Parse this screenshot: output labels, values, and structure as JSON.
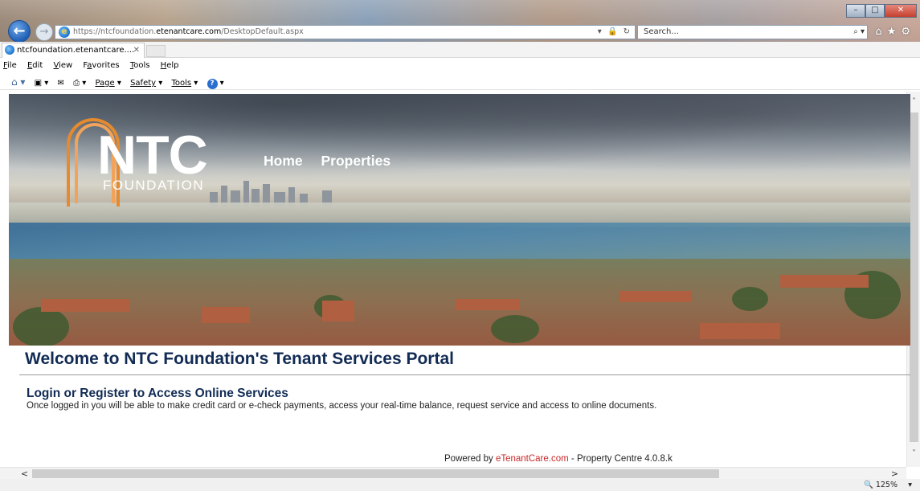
{
  "browser": {
    "url_prefix": "https://ntcfoundation.",
    "url_domain": "etenantcare.com",
    "url_path": "/DesktopDefault.aspx",
    "search_placeholder": "Search...",
    "tab_title": "ntcfoundation.etenantcare....",
    "zoom": "125%",
    "accent_color": "#1f5fb6"
  },
  "menu": [
    "File",
    "Edit",
    "View",
    "Favorites",
    "Tools",
    "Help"
  ],
  "command_bar": {
    "page": "Page",
    "safety": "Safety",
    "tools": "Tools"
  },
  "banner": {
    "logo_main": "NTC",
    "logo_sub": "FOUNDATION",
    "nav": [
      "Home",
      "Properties"
    ]
  },
  "content": {
    "welcome": "Welcome to NTC Foundation's Tenant Services Portal",
    "login_title": "Login or Register to Access Online Services",
    "login_desc": "Once logged in you will be able to make credit card or e-check payments, access your real-time balance, request service and access to online documents.",
    "footer_prefix": "Powered by ",
    "footer_link": "eTenantCare.com",
    "footer_suffix": " - Property Centre 4.0.8.k"
  }
}
